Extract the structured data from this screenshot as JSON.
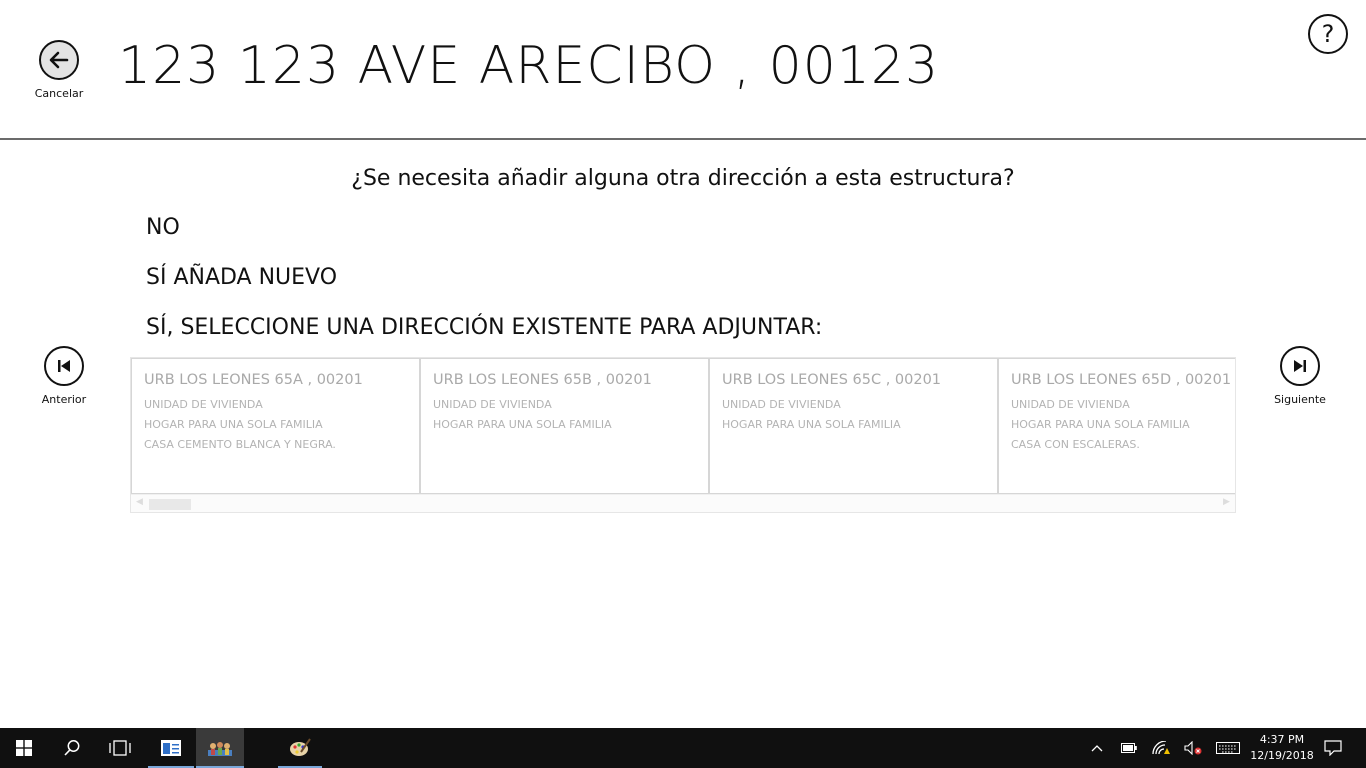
{
  "header": {
    "title": "123 123 AVE ARECIBO , 00123",
    "back_label": "Cancelar",
    "help_label": "?"
  },
  "question": "¿Se necesita añadir alguna otra dirección a esta estructura?",
  "options": [
    "NO",
    "SÍ AÑADA NUEVO",
    "SÍ, SELECCIONE UNA DIRECCIÓN EXISTENTE PARA ADJUNTAR:"
  ],
  "nav": {
    "previous_label": "Anterior",
    "next_label": "Siguiente"
  },
  "addresses": [
    {
      "title": "URB LOS LEONES 65A , 00201",
      "lines": [
        "UNIDAD DE VIVIENDA",
        "HOGAR PARA UNA SOLA FAMILIA",
        "CASA CEMENTO BLANCA Y NEGRA."
      ]
    },
    {
      "title": "URB LOS LEONES 65B , 00201",
      "lines": [
        "UNIDAD DE VIVIENDA",
        "HOGAR PARA UNA SOLA FAMILIA",
        ""
      ]
    },
    {
      "title": "URB LOS LEONES 65C , 00201",
      "lines": [
        "UNIDAD DE VIVIENDA",
        "HOGAR PARA UNA SOLA FAMILIA",
        ""
      ]
    },
    {
      "title": "URB LOS LEONES 65D , 00201",
      "lines": [
        "UNIDAD DE VIVIENDA",
        "HOGAR PARA UNA SOLA FAMILIA",
        "CASA CON ESCALERAS."
      ]
    }
  ],
  "taskbar": {
    "time": "4:37 PM",
    "date": "12/19/2018",
    "accent": "#7aa7d9"
  }
}
